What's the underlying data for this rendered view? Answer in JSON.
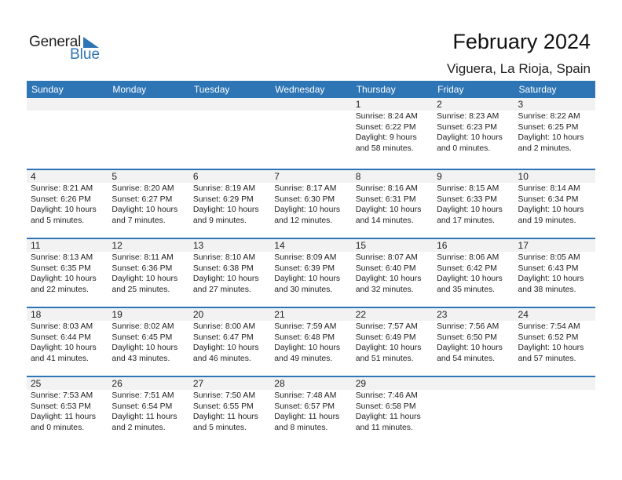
{
  "logo": {
    "part1": "General",
    "part2": "Blue",
    "accent_color": "#2e75b6"
  },
  "header": {
    "title": "February 2024",
    "location": "Viguera, La Rioja, Spain"
  },
  "weekdays": [
    "Sunday",
    "Monday",
    "Tuesday",
    "Wednesday",
    "Thursday",
    "Friday",
    "Saturday"
  ],
  "weeks": [
    [
      null,
      null,
      null,
      null,
      {
        "day": "1",
        "sunrise": "Sunrise: 8:24 AM",
        "sunset": "Sunset: 6:22 PM",
        "daylight1": "Daylight: 9 hours",
        "daylight2": "and 58 minutes."
      },
      {
        "day": "2",
        "sunrise": "Sunrise: 8:23 AM",
        "sunset": "Sunset: 6:23 PM",
        "daylight1": "Daylight: 10 hours",
        "daylight2": "and 0 minutes."
      },
      {
        "day": "3",
        "sunrise": "Sunrise: 8:22 AM",
        "sunset": "Sunset: 6:25 PM",
        "daylight1": "Daylight: 10 hours",
        "daylight2": "and 2 minutes."
      }
    ],
    [
      {
        "day": "4",
        "sunrise": "Sunrise: 8:21 AM",
        "sunset": "Sunset: 6:26 PM",
        "daylight1": "Daylight: 10 hours",
        "daylight2": "and 5 minutes."
      },
      {
        "day": "5",
        "sunrise": "Sunrise: 8:20 AM",
        "sunset": "Sunset: 6:27 PM",
        "daylight1": "Daylight: 10 hours",
        "daylight2": "and 7 minutes."
      },
      {
        "day": "6",
        "sunrise": "Sunrise: 8:19 AM",
        "sunset": "Sunset: 6:29 PM",
        "daylight1": "Daylight: 10 hours",
        "daylight2": "and 9 minutes."
      },
      {
        "day": "7",
        "sunrise": "Sunrise: 8:17 AM",
        "sunset": "Sunset: 6:30 PM",
        "daylight1": "Daylight: 10 hours",
        "daylight2": "and 12 minutes."
      },
      {
        "day": "8",
        "sunrise": "Sunrise: 8:16 AM",
        "sunset": "Sunset: 6:31 PM",
        "daylight1": "Daylight: 10 hours",
        "daylight2": "and 14 minutes."
      },
      {
        "day": "9",
        "sunrise": "Sunrise: 8:15 AM",
        "sunset": "Sunset: 6:33 PM",
        "daylight1": "Daylight: 10 hours",
        "daylight2": "and 17 minutes."
      },
      {
        "day": "10",
        "sunrise": "Sunrise: 8:14 AM",
        "sunset": "Sunset: 6:34 PM",
        "daylight1": "Daylight: 10 hours",
        "daylight2": "and 19 minutes."
      }
    ],
    [
      {
        "day": "11",
        "sunrise": "Sunrise: 8:13 AM",
        "sunset": "Sunset: 6:35 PM",
        "daylight1": "Daylight: 10 hours",
        "daylight2": "and 22 minutes."
      },
      {
        "day": "12",
        "sunrise": "Sunrise: 8:11 AM",
        "sunset": "Sunset: 6:36 PM",
        "daylight1": "Daylight: 10 hours",
        "daylight2": "and 25 minutes."
      },
      {
        "day": "13",
        "sunrise": "Sunrise: 8:10 AM",
        "sunset": "Sunset: 6:38 PM",
        "daylight1": "Daylight: 10 hours",
        "daylight2": "and 27 minutes."
      },
      {
        "day": "14",
        "sunrise": "Sunrise: 8:09 AM",
        "sunset": "Sunset: 6:39 PM",
        "daylight1": "Daylight: 10 hours",
        "daylight2": "and 30 minutes."
      },
      {
        "day": "15",
        "sunrise": "Sunrise: 8:07 AM",
        "sunset": "Sunset: 6:40 PM",
        "daylight1": "Daylight: 10 hours",
        "daylight2": "and 32 minutes."
      },
      {
        "day": "16",
        "sunrise": "Sunrise: 8:06 AM",
        "sunset": "Sunset: 6:42 PM",
        "daylight1": "Daylight: 10 hours",
        "daylight2": "and 35 minutes."
      },
      {
        "day": "17",
        "sunrise": "Sunrise: 8:05 AM",
        "sunset": "Sunset: 6:43 PM",
        "daylight1": "Daylight: 10 hours",
        "daylight2": "and 38 minutes."
      }
    ],
    [
      {
        "day": "18",
        "sunrise": "Sunrise: 8:03 AM",
        "sunset": "Sunset: 6:44 PM",
        "daylight1": "Daylight: 10 hours",
        "daylight2": "and 41 minutes."
      },
      {
        "day": "19",
        "sunrise": "Sunrise: 8:02 AM",
        "sunset": "Sunset: 6:45 PM",
        "daylight1": "Daylight: 10 hours",
        "daylight2": "and 43 minutes."
      },
      {
        "day": "20",
        "sunrise": "Sunrise: 8:00 AM",
        "sunset": "Sunset: 6:47 PM",
        "daylight1": "Daylight: 10 hours",
        "daylight2": "and 46 minutes."
      },
      {
        "day": "21",
        "sunrise": "Sunrise: 7:59 AM",
        "sunset": "Sunset: 6:48 PM",
        "daylight1": "Daylight: 10 hours",
        "daylight2": "and 49 minutes."
      },
      {
        "day": "22",
        "sunrise": "Sunrise: 7:57 AM",
        "sunset": "Sunset: 6:49 PM",
        "daylight1": "Daylight: 10 hours",
        "daylight2": "and 51 minutes."
      },
      {
        "day": "23",
        "sunrise": "Sunrise: 7:56 AM",
        "sunset": "Sunset: 6:50 PM",
        "daylight1": "Daylight: 10 hours",
        "daylight2": "and 54 minutes."
      },
      {
        "day": "24",
        "sunrise": "Sunrise: 7:54 AM",
        "sunset": "Sunset: 6:52 PM",
        "daylight1": "Daylight: 10 hours",
        "daylight2": "and 57 minutes."
      }
    ],
    [
      {
        "day": "25",
        "sunrise": "Sunrise: 7:53 AM",
        "sunset": "Sunset: 6:53 PM",
        "daylight1": "Daylight: 11 hours",
        "daylight2": "and 0 minutes."
      },
      {
        "day": "26",
        "sunrise": "Sunrise: 7:51 AM",
        "sunset": "Sunset: 6:54 PM",
        "daylight1": "Daylight: 11 hours",
        "daylight2": "and 2 minutes."
      },
      {
        "day": "27",
        "sunrise": "Sunrise: 7:50 AM",
        "sunset": "Sunset: 6:55 PM",
        "daylight1": "Daylight: 11 hours",
        "daylight2": "and 5 minutes."
      },
      {
        "day": "28",
        "sunrise": "Sunrise: 7:48 AM",
        "sunset": "Sunset: 6:57 PM",
        "daylight1": "Daylight: 11 hours",
        "daylight2": "and 8 minutes."
      },
      {
        "day": "29",
        "sunrise": "Sunrise: 7:46 AM",
        "sunset": "Sunset: 6:58 PM",
        "daylight1": "Daylight: 11 hours",
        "daylight2": "and 11 minutes."
      },
      null,
      null
    ]
  ]
}
